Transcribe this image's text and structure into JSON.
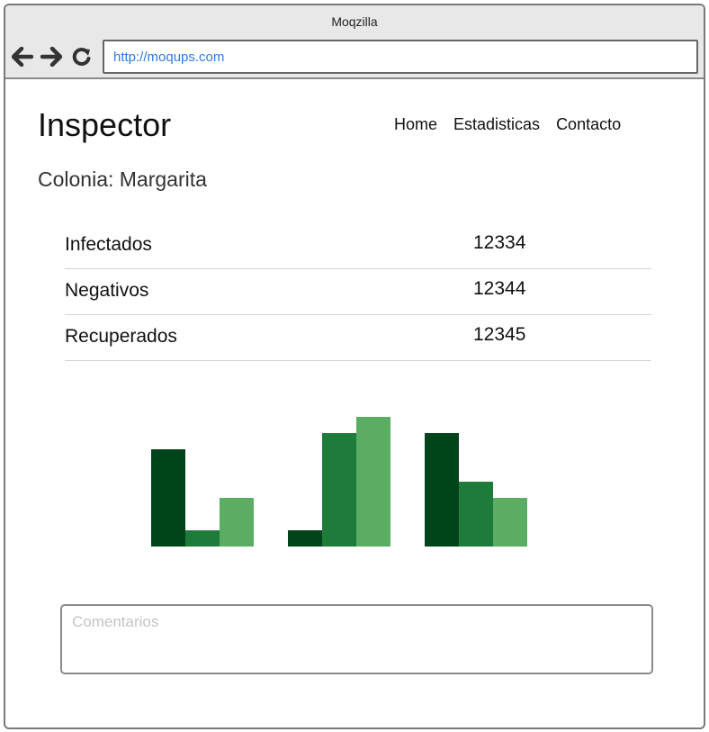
{
  "window": {
    "title": "Moqzilla"
  },
  "browser": {
    "url": "http://moqups.com",
    "icons": [
      "back-arrow-icon",
      "forward-arrow-icon",
      "reload-icon"
    ]
  },
  "header": {
    "title": "Inspector",
    "nav": [
      "Home",
      "Estadisticas",
      "Contacto"
    ]
  },
  "colonia": {
    "label": "Colonia: Margarita"
  },
  "stats": [
    {
      "label": "Infectados",
      "value": "12334"
    },
    {
      "label": "Negativos",
      "value": "12344"
    },
    {
      "label": "Recuperados",
      "value": "12345"
    }
  ],
  "chart_data": {
    "type": "bar",
    "categories": [
      "",
      "",
      ""
    ],
    "series": [
      {
        "values": [
          6,
          1,
          7
        ],
        "color": "#00441b"
      },
      {
        "values": [
          1,
          7,
          4
        ],
        "color": "#1e7b3a"
      },
      {
        "values": [
          3,
          8,
          3
        ],
        "color": "#5aad63"
      }
    ],
    "ylim": [
      0,
      8
    ],
    "grid": false,
    "axes": false
  },
  "comments": {
    "placeholder": "Comentarios"
  }
}
